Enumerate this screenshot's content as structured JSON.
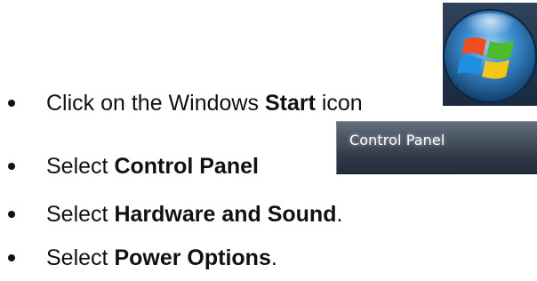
{
  "steps": [
    {
      "prefix": "Click on the Windows ",
      "bold": "Start",
      "suffix": " icon"
    },
    {
      "prefix": "Select ",
      "bold": "Control Panel",
      "suffix": ""
    },
    {
      "prefix": "Select ",
      "bold": "Hardware and Sound",
      "suffix": "."
    },
    {
      "prefix": "Select ",
      "bold": "Power Options",
      "suffix": "."
    }
  ],
  "control_panel_item": {
    "label": "Control Panel"
  },
  "start_orb": {
    "icon": "windows-start-orb-icon",
    "colors": {
      "background": "#2a3c52",
      "red": "#ee4d1f",
      "green": "#4cbc2a",
      "blue": "#1e8ee0",
      "yellow": "#f6c51a"
    }
  }
}
